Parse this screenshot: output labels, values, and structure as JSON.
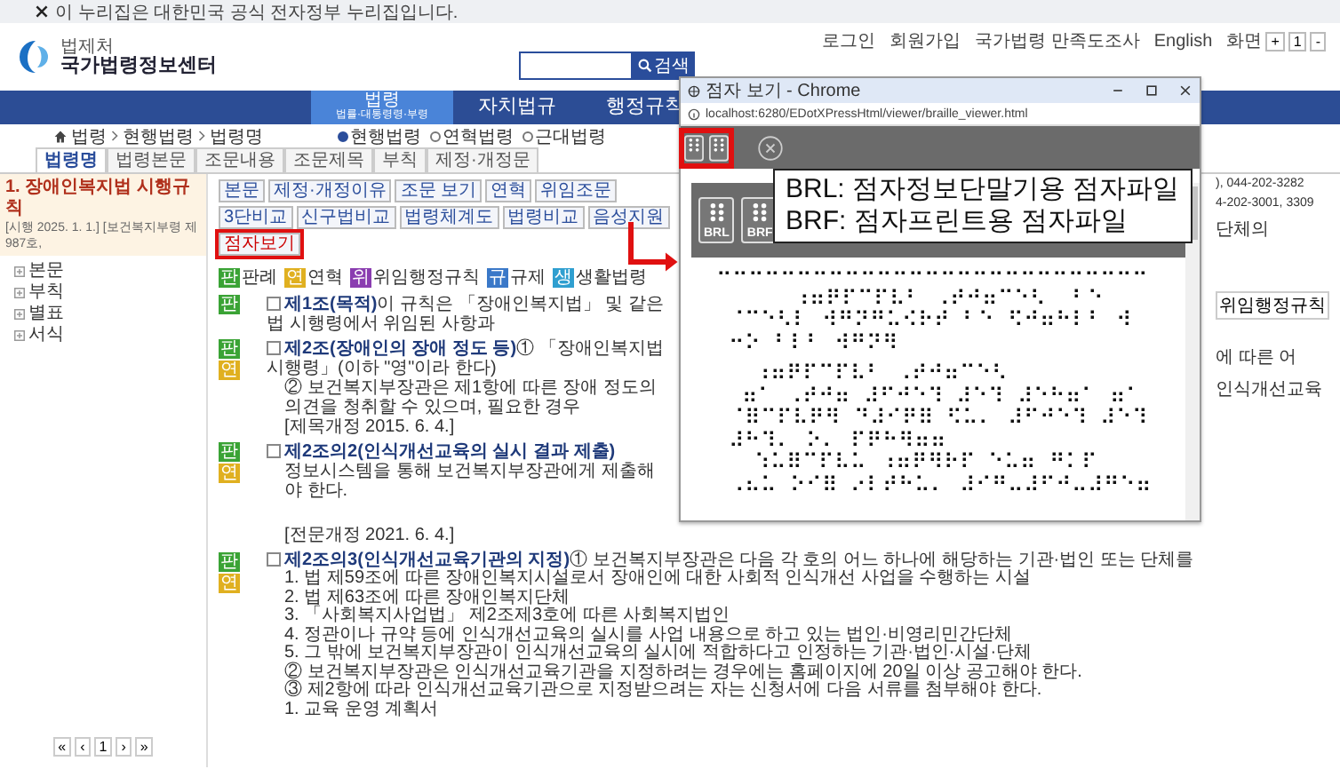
{
  "notice": "이 누리집은 대한민국 공식 전자정부 누리집입니다.",
  "logo": {
    "org": "법제처",
    "name": "국가법령정보센터"
  },
  "search": {
    "button": "검색"
  },
  "top_links": [
    "로그인",
    "회원가입",
    "국가법령 만족도조사",
    "English",
    "화면"
  ],
  "font_buttons": [
    "+",
    "1",
    "-"
  ],
  "nav": [
    {
      "label": "법령",
      "sub": "법률·대통령령·부령",
      "selected": true
    },
    {
      "label": "자치법규",
      "selected": false
    },
    {
      "label": "행정규칙",
      "selected": false
    }
  ],
  "breadcrumb": [
    "법령",
    "현행법령",
    "법령명"
  ],
  "scope_options": [
    {
      "label": "현행법령",
      "selected": true
    },
    {
      "label": "연혁법령",
      "selected": false
    },
    {
      "label": "근대법령",
      "selected": false
    }
  ],
  "tabs": [
    {
      "label": "법령명",
      "selected": true
    },
    {
      "label": "법령본문",
      "selected": false
    },
    {
      "label": "조문내용",
      "selected": false
    },
    {
      "label": "조문제목",
      "selected": false
    },
    {
      "label": "부칙",
      "selected": false
    },
    {
      "label": "제정·개정문",
      "selected": false
    }
  ],
  "sidebar": {
    "title": "1. 장애인복지법 시행규칙",
    "meta": "[시행 2025. 1. 1.] [보건복지부령 제987호,",
    "tree": [
      "본문",
      "부칙",
      "별표",
      "서식"
    ],
    "pager": [
      "«",
      "‹",
      "1",
      "›",
      "»"
    ]
  },
  "toolbar": [
    {
      "label": "본문",
      "highlighted": false
    },
    {
      "label": "제정·개정이유",
      "highlighted": false
    },
    {
      "label": "조문 보기",
      "highlighted": false
    },
    {
      "label": "연혁",
      "highlighted": false
    },
    {
      "label": "위임조문",
      "highlighted": false
    },
    {
      "label": "3단비교",
      "highlighted": false
    },
    {
      "label": "신구법비교",
      "highlighted": false
    },
    {
      "label": "법령체계도",
      "highlighted": false
    },
    {
      "label": "법령비교",
      "highlighted": false
    },
    {
      "label": "음성지원",
      "highlighted": false
    },
    {
      "label": "점자보기",
      "highlighted": true
    }
  ],
  "legend": [
    {
      "mark": "판",
      "label": "판례",
      "color": "#3aa335"
    },
    {
      "mark": "연",
      "label": "연혁",
      "color": "#e0b020"
    },
    {
      "mark": "위",
      "label": "위임행정규칙",
      "color": "#8a3db0"
    },
    {
      "mark": "규",
      "label": "규제",
      "color": "#3a78c8"
    },
    {
      "mark": "생",
      "label": "생활법령",
      "color": "#2f9fd0"
    }
  ],
  "articles_upper": [
    {
      "tags": [
        {
          "mark": "판",
          "color": "#3aa335"
        }
      ],
      "checked": false,
      "title": "제1조(목적)",
      "text": "이 규칙은 「장애인복지법」 및 같은 법 시행령에서 위임된 사항과"
    },
    {
      "tags": [
        {
          "mark": "판",
          "color": "#3aa335"
        },
        {
          "mark": "연",
          "color": "#e0b020"
        }
      ],
      "checked": false,
      "title": "제2조(장애인의 장애 정도 등)",
      "text": "① 「장애인복지법 시행령」(이하 \"영\"이라 한다)",
      "lines": [
        "② 보건복지부장관은 제1항에 따른 장애 정도의",
        "의견을 청취할 수 있으며, 필요한 경우",
        "[제목개정 2015. 6. 4.]"
      ]
    },
    {
      "tags": [
        {
          "mark": "판",
          "color": "#3aa335"
        },
        {
          "mark": "연",
          "color": "#e0b020"
        }
      ],
      "checked": false,
      "title": "제2조의2(인식개선교육의 실시 결과 제출)",
      "lines": [
        "정보시스템을 통해 보건복지부장관에게 제출해야 한다."
      ]
    }
  ],
  "articles_lower": [
    {
      "lines": [
        "[전문개정 2021. 6. 4.]"
      ]
    },
    {
      "tags": [
        {
          "mark": "판",
          "color": "#3aa335"
        },
        {
          "mark": "연",
          "color": "#e0b020"
        }
      ],
      "checked": false,
      "title": "제2조의3(인식개선교육기관의 지정)",
      "text": "① 보건복지부장관은 다음 각 호의 어느 하나에 해당하는 기관·법인 또는 단체를",
      "lines": [
        "1. 법 제59조에 따른 장애인복지시설로서 장애인에 대한 사회적 인식개선 사업을 수행하는 시설",
        "2. 법 제63조에 따른 장애인복지단체",
        "3. 「사회복지사업법」 제2조제3호에 따른 사회복지법인",
        "4. 정관이나 규약 등에 인식개선교육의 실시를 사업 내용으로 하고 있는 법인·비영리민간단체",
        "5. 그 밖에 보건복지부장관이 인식개선교육의 실시에 적합하다고 인정하는 기관·법인·시설·단체",
        "② 보건복지부장관은 인식개선교육기관을 지정하려는 경우에는 홈페이지에 20일 이상 공고해야 한다.",
        "③ 제2항에 따라 인식개선교육기관으로 지정받으려는 자는 신청서에 다음 서류를 첨부해야 한다.",
        "1. 교육 운영 계획서"
      ]
    }
  ],
  "right_fragments": [
    "), 044-202-3282",
    "4-202-3001, 3309",
    "단체의"
  ],
  "right_button": "위임행정규칙",
  "right_fragments_lower": [
    "에 따른 어",
    "인식개선교육"
  ],
  "popup": {
    "title": "점자 보기 - Chrome",
    "url": "localhost:6280/EDotXPressHtml/viewer/braille_viewer.html",
    "toolbar_highlighted": true,
    "files": [
      "BRL",
      "BRF"
    ],
    "callout": [
      "BRL: 점자정보단말기용 점자파일",
      "BRF: 점자프린트용 점자파일"
    ],
    "braille": [
      "⠒⠒⠒⠒⠒⠒⠒⠒⠒⠒⠒⠒⠒⠒⠒⠒⠒⠒⠒⠒⠒⠒⠒⠒⠒⠒⠒",
      "      ⠰⠶⠟⠏⠉⠏⠧⠃ ⠠⠞⠚⠶⠉⠑⠣  ⠃⠑",
      " ⠈⠉⠑⠣⠇ ⠺⠛⠝⠛⠥⠪⠗⠞ ⠃⠑ ⠫⠚⠶⠓⠇⠃ ⠺",
      " ⠒⠕ ⠃⠇⠃ ⠺⠛⠝⠻",
      "   ⠰⠶⠟⠏⠉⠏⠧⠃ ⠠⠞⠚⠶⠉⠑⠣",
      "  ⠶⠁ ⠠⠞⠚⠶ ⠼⠋⠚⠑⠹ ⠼⠑⠹ ⠼⠑⠓⠶⠁ ⠶⠁",
      " ⠈⠿⠉⠏⠧⠟⠻ ⠙⠼⠊⠟⠿ ⠫⠥⠄ ⠼⠋⠚⠑⠹ ⠼⠑⠹",
      " ⠼⠓⠹⠄ ⠕⠄ ⠏⠟⠓⠻⠶⠶",
      "   ⠱⠥⠿⠉⠏⠧⠥ ⠰⠶⠟⠻⠗⠏ ⠑⠥⠶ ⠛⠅⠏",
      " ⠠⠦⠥ ⠕⠊⠿ ⠔⠇⠞⠓⠥⠄ ⠼⠊⠛⠤⠼⠋⠚⠤⠼⠛⠑⠶"
    ]
  }
}
